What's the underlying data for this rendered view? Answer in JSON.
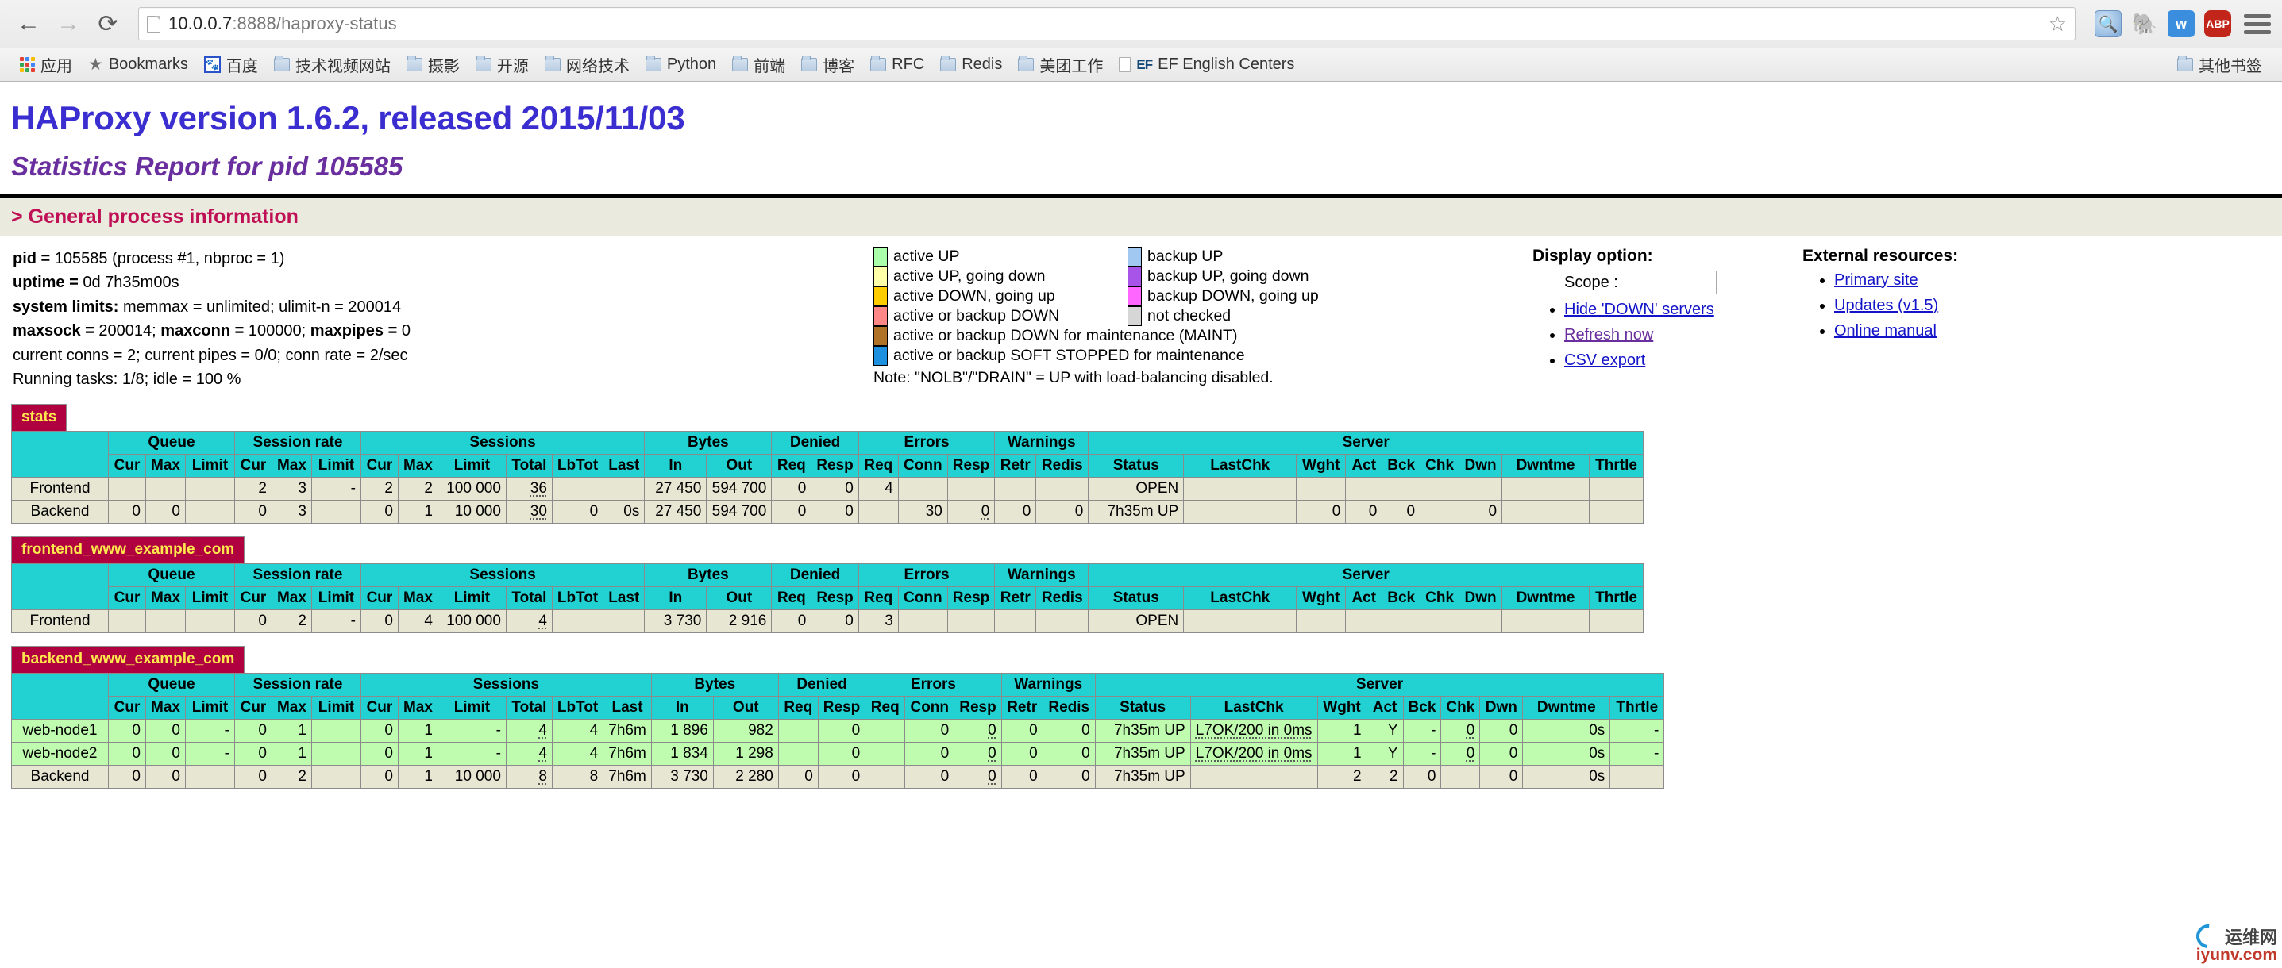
{
  "browser": {
    "back_icon": "back-arrow-icon",
    "forward_icon": "forward-arrow-icon",
    "reload_icon": "reload-icon",
    "url_host": "10.0.0.7",
    "url_rest": ":8888/haproxy-status",
    "url_full": "10.0.0.7:8888/haproxy-status",
    "star_glyph": "☆",
    "extensions": [
      {
        "name": "magnifier-extension-icon",
        "label": "🔍"
      },
      {
        "name": "evernote-extension-icon",
        "label": "🐘"
      },
      {
        "name": "wiz-extension-icon",
        "label": "w"
      },
      {
        "name": "adblock-plus-extension-icon",
        "label": "ABP"
      }
    ],
    "menu_icon": "hamburger-menu-icon"
  },
  "bookmarks": {
    "apps_label": "应用",
    "items": [
      {
        "label": "Bookmarks",
        "icon": "star-icon"
      },
      {
        "label": "百度",
        "icon": "baidu-icon"
      },
      {
        "label": "技术视频网站",
        "icon": "folder-icon"
      },
      {
        "label": "摄影",
        "icon": "folder-icon"
      },
      {
        "label": "开源",
        "icon": "folder-icon"
      },
      {
        "label": "网络技术",
        "icon": "folder-icon"
      },
      {
        "label": "Python",
        "icon": "folder-icon"
      },
      {
        "label": "前端",
        "icon": "folder-icon"
      },
      {
        "label": "博客",
        "icon": "folder-icon"
      },
      {
        "label": "RFC",
        "icon": "folder-icon"
      },
      {
        "label": "Redis",
        "icon": "folder-icon"
      },
      {
        "label": "美团工作",
        "icon": "folder-icon"
      },
      {
        "label": "EF English Centers",
        "icon": "ef-icon"
      }
    ],
    "other_bookmarks": "其他书签"
  },
  "page": {
    "title": "HAProxy version 1.6.2, released 2015/11/03",
    "subtitle": "Statistics Report for pid 105585",
    "section_heading": "> General process information",
    "process_info": [
      {
        "label": "pid = ",
        "value": "105585 (process #1, nbproc = 1)"
      },
      {
        "label": "uptime = ",
        "value": "0d 7h35m00s"
      },
      {
        "label": "system limits:",
        "value": " memmax = unlimited; ulimit-n = 200014"
      },
      {
        "label": "maxsock = ",
        "value": "200014; ",
        "label2": "maxconn = ",
        "value2": "100000; ",
        "label3": "maxpipes = ",
        "value3": "0"
      },
      {
        "label": "",
        "value": "current conns = 2; current pipes = 0/0; conn rate = 2/sec"
      },
      {
        "label": "",
        "value": "Running tasks: 1/8; idle = 100 %"
      }
    ],
    "legend_left": [
      {
        "color": "#aaffaa",
        "text": "active UP"
      },
      {
        "color": "#ffffaa",
        "text": "active UP, going down"
      },
      {
        "color": "#ffcc00",
        "text": "active DOWN, going up"
      },
      {
        "color": "#ff8787",
        "text": "active or backup DOWN"
      },
      {
        "color": "#b07226",
        "text": "active or backup DOWN for maintenance (MAINT)"
      },
      {
        "color": "#1e90e0",
        "text": "active or backup SOFT STOPPED for maintenance"
      }
    ],
    "legend_right": [
      {
        "color": "#a0c8f0",
        "text": "backup UP"
      },
      {
        "color": "#a854e8",
        "text": "backup UP, going down"
      },
      {
        "color": "#ff66ff",
        "text": "backup DOWN, going up"
      },
      {
        "color": "#d6d6d6",
        "text": "not checked"
      }
    ],
    "legend_note": "Note: \"NOLB\"/\"DRAIN\" = UP with load-balancing disabled.",
    "display_option": {
      "title": "Display option:",
      "scope_label": "Scope :",
      "scope_value": "",
      "links": [
        "Hide 'DOWN' servers",
        "Refresh now",
        "CSV export"
      ]
    },
    "external_resources": {
      "title": "External resources:",
      "links": [
        "Primary site",
        "Updates (v1.5)",
        "Online manual"
      ]
    },
    "group_headers": [
      "",
      "Queue",
      "Session rate",
      "Sessions",
      "Bytes",
      "Denied",
      "Errors",
      "Warnings",
      "Server"
    ],
    "sub_headers": [
      "",
      "Cur",
      "Max",
      "Limit",
      "Cur",
      "Max",
      "Limit",
      "Cur",
      "Max",
      "Limit",
      "Total",
      "LbTot",
      "Last",
      "In",
      "Out",
      "Req",
      "Resp",
      "Req",
      "Conn",
      "Resp",
      "Retr",
      "Redis",
      "Status",
      "LastChk",
      "Wght",
      "Act",
      "Bck",
      "Chk",
      "Dwn",
      "Dwntme",
      "Thrtle"
    ],
    "proxies": [
      {
        "name": "stats",
        "rows": [
          {
            "kind": "frontend",
            "cells": [
              "Frontend",
              "",
              "",
              "",
              "2",
              "3",
              "-",
              "2",
              "2",
              "100 000",
              "36",
              "",
              "",
              "27 450",
              "594 700",
              "0",
              "0",
              "4",
              "",
              "",
              "",
              "",
              "OPEN",
              "",
              "",
              "",
              "",
              "",
              "",
              "",
              ""
            ]
          },
          {
            "kind": "backend",
            "cells": [
              "Backend",
              "0",
              "0",
              "",
              "0",
              "3",
              "",
              "0",
              "1",
              "10 000",
              "30",
              "0",
              "0s",
              "27 450",
              "594 700",
              "0",
              "0",
              "",
              "30",
              "0",
              "0",
              "0",
              "7h35m UP",
              "",
              "0",
              "0",
              "0",
              "",
              "0",
              "",
              ""
            ]
          }
        ]
      },
      {
        "name": "frontend_www_example_com",
        "rows": [
          {
            "kind": "frontend",
            "cells": [
              "Frontend",
              "",
              "",
              "",
              "0",
              "2",
              "-",
              "0",
              "4",
              "100 000",
              "4",
              "",
              "",
              "3 730",
              "2 916",
              "0",
              "0",
              "3",
              "",
              "",
              "",
              "",
              "OPEN",
              "",
              "",
              "",
              "",
              "",
              "",
              "",
              ""
            ]
          }
        ]
      },
      {
        "name": "backend_www_example_com",
        "rows": [
          {
            "kind": "active",
            "cells": [
              "web-node1",
              "0",
              "0",
              "-",
              "0",
              "1",
              "",
              "0",
              "1",
              "-",
              "4",
              "4",
              "7h6m",
              "1 896",
              "982",
              "",
              "0",
              "",
              "0",
              "0",
              "0",
              "0",
              "7h35m UP",
              "L7OK/200 in 0ms",
              "1",
              "Y",
              "-",
              "0",
              "0",
              "0s",
              "-"
            ]
          },
          {
            "kind": "active",
            "cells": [
              "web-node2",
              "0",
              "0",
              "-",
              "0",
              "1",
              "",
              "0",
              "1",
              "-",
              "4",
              "4",
              "7h6m",
              "1 834",
              "1 298",
              "",
              "0",
              "",
              "0",
              "0",
              "0",
              "0",
              "7h35m UP",
              "L7OK/200 in 0ms",
              "1",
              "Y",
              "-",
              "0",
              "0",
              "0s",
              "-"
            ]
          },
          {
            "kind": "backend",
            "cells": [
              "Backend",
              "0",
              "0",
              "",
              "0",
              "2",
              "",
              "0",
              "1",
              "10 000",
              "8",
              "8",
              "7h6m",
              "3 730",
              "2 280",
              "0",
              "0",
              "",
              "0",
              "0",
              "0",
              "0",
              "7h35m UP",
              "",
              "2",
              "2",
              "0",
              "",
              "0",
              "0s",
              ""
            ]
          }
        ]
      }
    ],
    "watermark": {
      "cn": "运维网",
      "url": "iyunv.com"
    }
  },
  "colors": {
    "title": "#3b2ed0",
    "subtitle": "#6a2f9e",
    "section": "#c01055",
    "proxy_name_bg": "#b00040",
    "proxy_name_fg": "#ffe84d",
    "table_header_bg": "#22d2d2",
    "row_frontend_bg": "#e6e6d3",
    "row_active_bg": "#c0fcb0",
    "band_bg": "#eaeadf"
  }
}
